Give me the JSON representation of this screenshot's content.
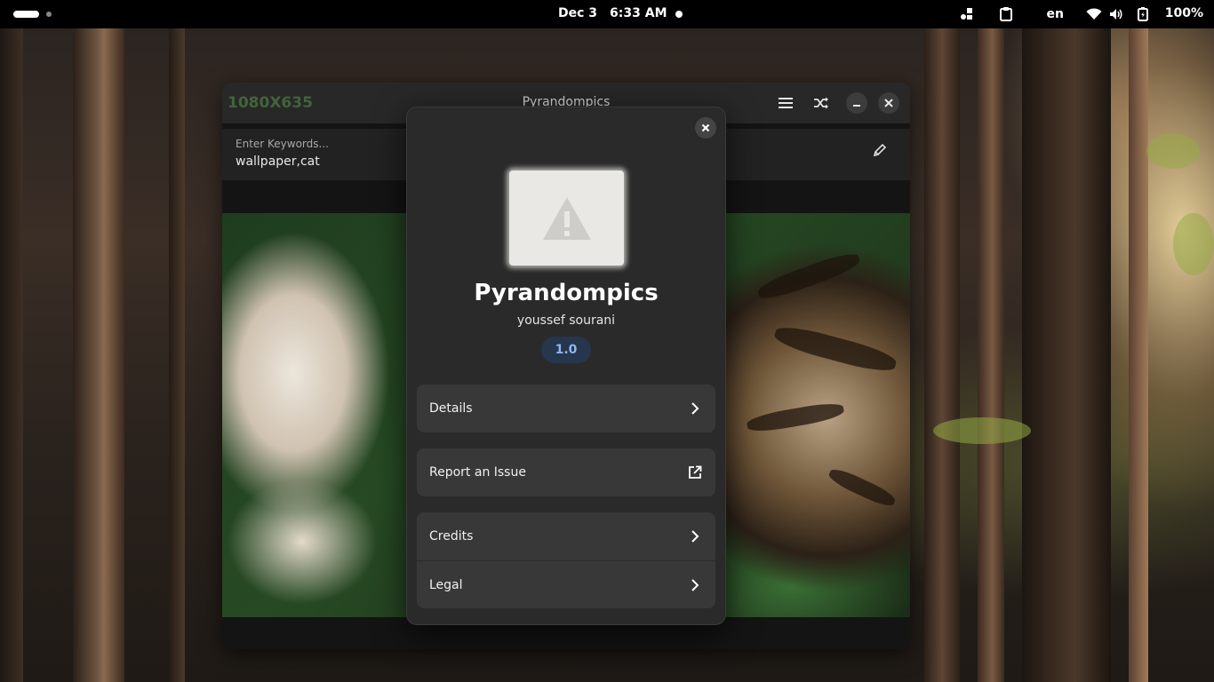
{
  "topbar": {
    "date": "Dec 3",
    "time": "6:33 AM",
    "language": "en",
    "battery": "100%"
  },
  "window": {
    "resolution": "1080X635",
    "title": "Pyrandompics",
    "keywords_label": "Enter Keywords...",
    "keywords_value": "wallpaper,cat"
  },
  "about": {
    "app_name": "Pyrandompics",
    "developer": "youssef sourani",
    "version": "1.0",
    "rows": [
      {
        "label": "Details",
        "icon": "chevron-right-icon"
      },
      {
        "label": "Report an Issue",
        "icon": "external-link-icon"
      },
      {
        "label": "Credits",
        "icon": "chevron-right-icon"
      },
      {
        "label": "Legal",
        "icon": "chevron-right-icon"
      }
    ]
  },
  "colors": {
    "resolution_text": "#41643a",
    "version_badge_bg": "#26364c",
    "version_badge_text": "#8fb6ee",
    "dialog_bg": "#2a2a2a",
    "row_bg": "#383838"
  }
}
